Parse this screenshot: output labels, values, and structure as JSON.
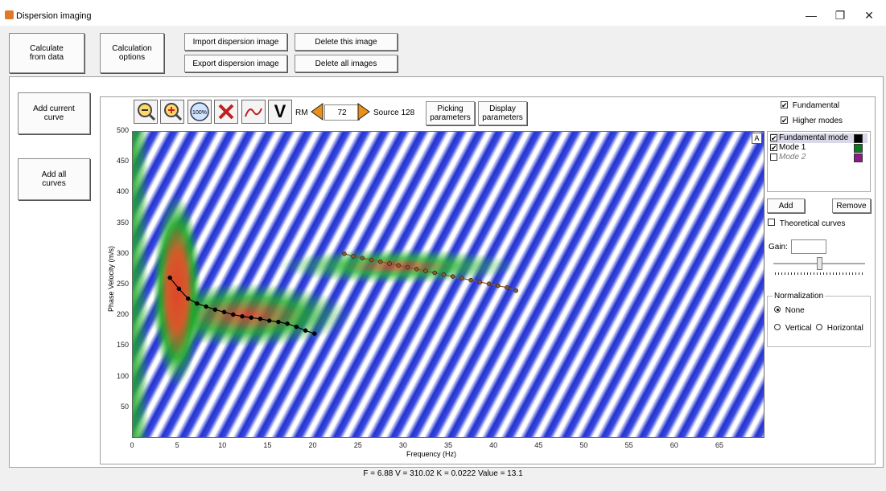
{
  "window": {
    "title": "Dispersion imaging",
    "minimize": "—",
    "restore": "❐",
    "close": "✕"
  },
  "top_buttons": {
    "calc_from_data": "Calculate\nfrom data",
    "calc_options": "Calculation\noptions",
    "import_image": "Import dispersion image",
    "export_image": "Export dispersion image",
    "delete_this": "Delete this image",
    "delete_all": "Delete all images"
  },
  "left_buttons": {
    "add_current": "Add current\ncurve",
    "add_all": "Add all\ncurves"
  },
  "toolbar": {
    "icons": [
      "zoom-out-icon",
      "zoom-in-icon",
      "zoom-100-icon",
      "delete-x-icon",
      "curve-icon"
    ],
    "zoom_100_label": "100%",
    "v_label": "V",
    "rm_label": "RM",
    "rm_value": "72",
    "source_label": "Source 128",
    "picking_params": "Picking\nparameters",
    "display_params": "Display\nparameters"
  },
  "plot": {
    "corner_label": "A"
  },
  "chart_data": {
    "type": "heatmap",
    "xlabel": "Frequency (Hz)",
    "ylabel": "Phase Velocity (m/s)",
    "xlim": [
      0,
      70
    ],
    "ylim": [
      0,
      500
    ],
    "x_ticks": [
      0,
      5,
      10,
      15,
      20,
      25,
      30,
      35,
      40,
      45,
      50,
      55,
      60,
      65
    ],
    "y_ticks": [
      50,
      100,
      150,
      200,
      250,
      300,
      350,
      400,
      450,
      500
    ],
    "series": [
      {
        "color": "#000000",
        "x": [
          4.2,
          5.2,
          6.2,
          7.2,
          8.2,
          9.2,
          10.2,
          11.2,
          12.2,
          13.2,
          14.2,
          15.2,
          16.2,
          17.2,
          18.2,
          19.2,
          20.2
        ],
        "y": [
          261,
          243,
          227,
          219,
          214,
          209,
          205,
          201,
          198,
          196,
          194,
          191,
          189,
          186,
          181,
          175,
          170
        ]
      },
      {
        "color": "#8b5a2b",
        "x": [
          23.5,
          24.5,
          25.5,
          26.5,
          27.5,
          28.5,
          29.5,
          30.5,
          31.5,
          32.5,
          33.5,
          34.5,
          35.5,
          36.5,
          37.5,
          38.5,
          39.5,
          40.5,
          41.5,
          42.5
        ],
        "y": [
          300,
          296,
          293,
          290,
          287,
          284,
          281,
          278,
          275,
          272,
          269,
          266,
          263,
          260,
          257,
          254,
          251,
          248,
          245,
          240
        ]
      }
    ]
  },
  "right_panel": {
    "fundamental": {
      "label": "Fundamental",
      "checked": "✔"
    },
    "higher_modes": {
      "label": "Higher modes",
      "checked": "✔"
    },
    "modes": [
      {
        "label": "Fundamental mode",
        "checked": "✔",
        "color": "#000000"
      },
      {
        "label": "Mode 1",
        "checked": "✔",
        "color": "#0a7a1e"
      },
      {
        "label": "Mode 2",
        "checked": "",
        "color": "#8b1a8b"
      }
    ],
    "add": "Add",
    "remove": "Remove",
    "theoretical_curves": "Theoretical curves",
    "gain_label": "Gain:",
    "gain_value": "",
    "normalization": {
      "title": "Normalization",
      "none": "None",
      "vertical": "Vertical",
      "horizontal": "Horizontal"
    }
  },
  "status": {
    "text": "F = 6.88 V = 310.02 K = 0.0222 Value = 13.1"
  }
}
